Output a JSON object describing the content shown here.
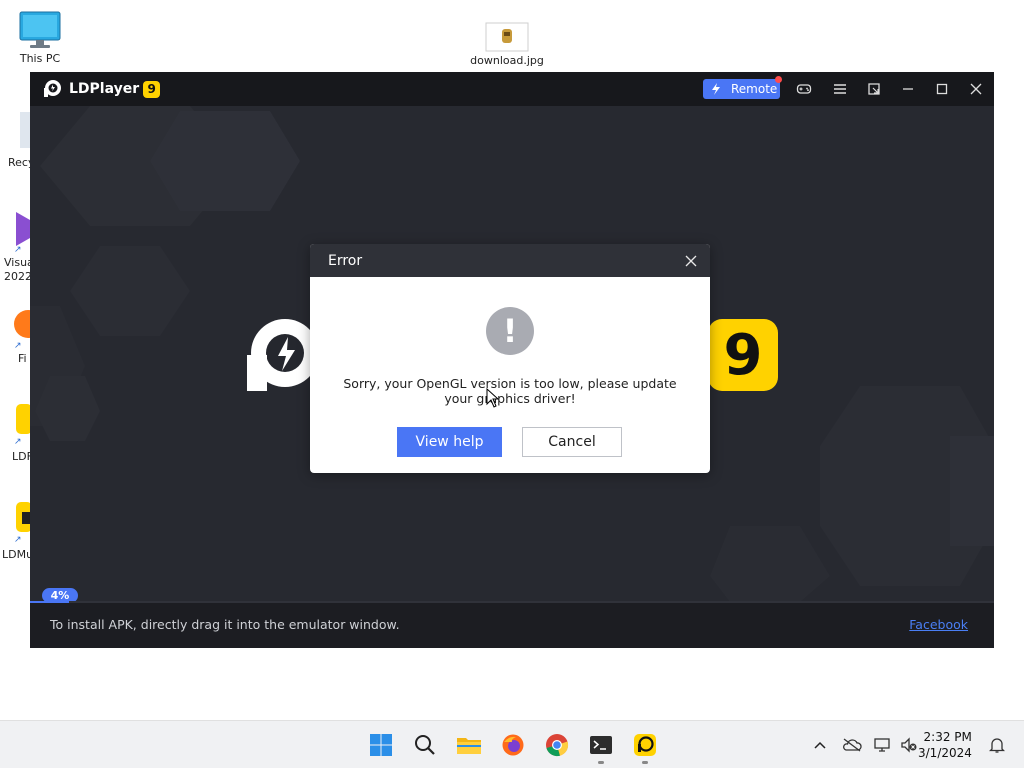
{
  "desktop": {
    "icons": [
      {
        "label": "This PC"
      },
      {
        "label": "download.jpg"
      }
    ],
    "partial_labels": [
      "Recy",
      "Visua",
      "2022",
      "Fi",
      "LDF",
      "LDMu"
    ]
  },
  "window": {
    "app_title": "LDPlayer",
    "version_badge": "9",
    "remote_label": "Remote",
    "splash_badge": "9",
    "progress": {
      "label": "4%",
      "value": 4
    },
    "footer": {
      "tip": "To install APK, directly drag it into the emulator window.",
      "link": "Facebook"
    }
  },
  "dialog": {
    "title": "Error",
    "icon": "!",
    "message": "Sorry, your OpenGL version is too low, please update your graphics driver!",
    "buttons": {
      "view_help": "View help",
      "cancel": "Cancel"
    }
  },
  "taskbar": {
    "apps": [
      "start",
      "search",
      "file-explorer",
      "firefox",
      "chrome",
      "terminal",
      "ldplayer"
    ],
    "clock": {
      "time": "2:32 PM",
      "date": "3/1/2024"
    }
  },
  "colors": {
    "accent": "#4a76f5",
    "brand_yellow": "#ffd200",
    "title_bar": "#17181c",
    "dialog_header": "#2f3138"
  }
}
